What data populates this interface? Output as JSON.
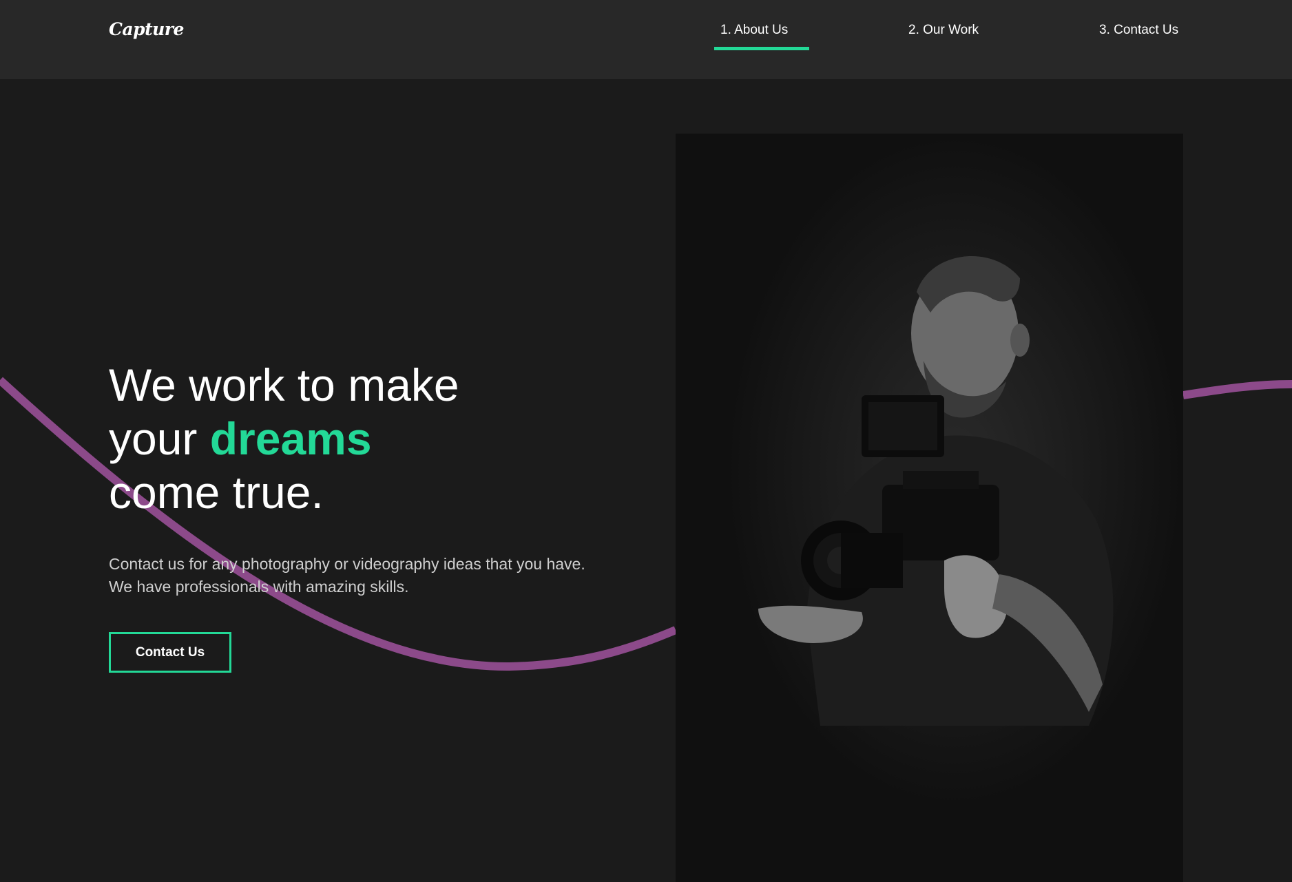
{
  "brand": {
    "logo": "Capture"
  },
  "nav": {
    "items": [
      {
        "label": "1. About Us",
        "active": true
      },
      {
        "label": "2. Our Work",
        "active": false
      },
      {
        "label": "3. Contact Us",
        "active": false
      }
    ]
  },
  "hero": {
    "line1": "We work to make",
    "line2_prefix": "your ",
    "line2_accent": "dreams",
    "line3": "come true.",
    "description": "Contact us for any photography or videography ideas that you have. We have professionals with amazing skills.",
    "cta_label": "Contact Us"
  },
  "colors": {
    "accent": "#23d997",
    "curve": "#8c4a8a",
    "background": "#1b1b1b",
    "nav_background": "#282828"
  }
}
